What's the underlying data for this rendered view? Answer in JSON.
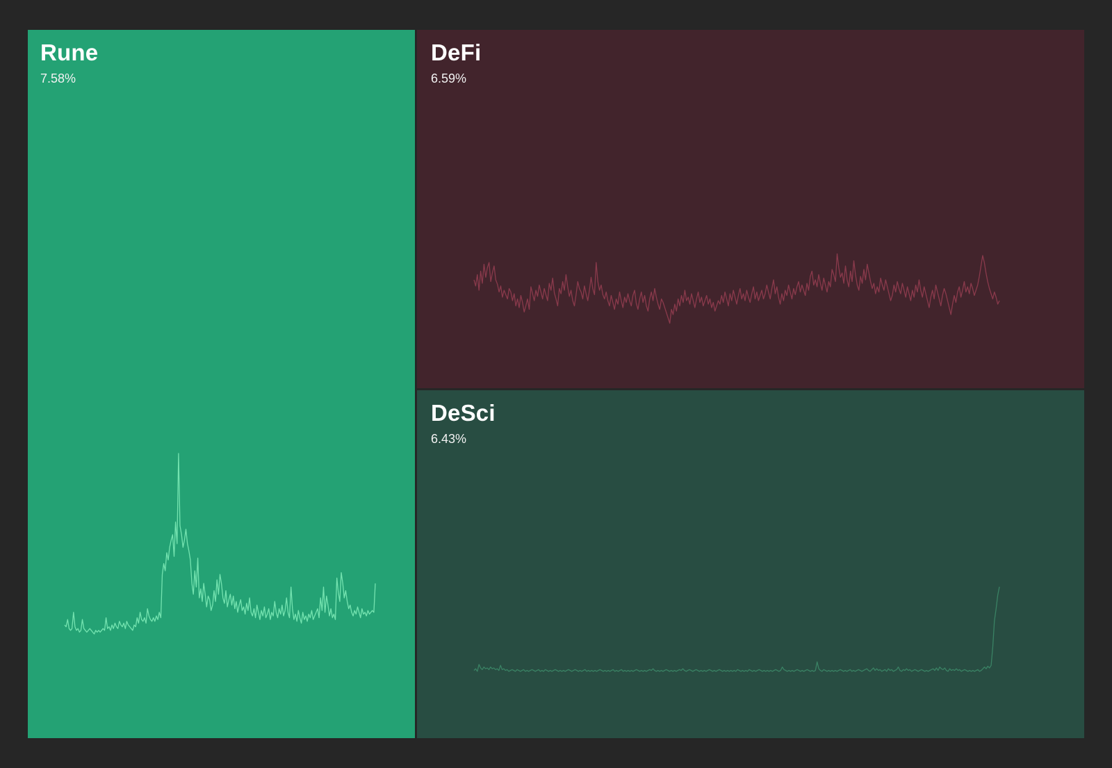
{
  "tiles": [
    {
      "id": "rune",
      "name": "Rune",
      "change": "7.58%",
      "background": "#24a274",
      "line_color": "#74e3b0",
      "sparkline": "0.05,0.04,0.08,0.03,0.02,0.03,0.12,0.04,0.02,0.03,0.01,0.02,0.08,0.03,0.02,0.01,0.02,0.03,0.02,0.01,0.0,0.02,0.01,0.02,0.01,0.02,0.03,0.02,0.09,0.03,0.04,0.02,0.05,0.03,0.06,0.04,0.03,0.07,0.05,0.04,0.06,0.03,0.07,0.05,0.04,0.03,0.02,0.05,0.04,0.09,0.06,0.12,0.08,0.07,0.09,0.06,0.14,0.1,0.08,0.07,0.09,0.07,0.1,0.08,0.12,0.09,0.33,0.39,0.35,0.45,0.41,0.48,0.52,0.55,0.43,0.62,0.5,1.0,0.6,0.55,0.48,0.52,0.58,0.5,0.46,0.41,0.28,0.22,0.35,0.26,0.42,0.2,0.25,0.18,0.28,0.22,0.15,0.21,0.19,0.13,0.16,0.24,0.18,0.3,0.22,0.33,0.28,0.2,0.17,0.24,0.15,0.19,0.22,0.16,0.21,0.14,0.18,0.12,0.16,0.19,0.13,0.15,0.11,0.17,0.13,0.2,0.12,0.1,0.14,0.09,0.16,0.12,0.08,0.13,0.1,0.15,0.09,0.11,0.14,0.08,0.12,0.1,0.18,0.12,0.09,0.14,0.11,0.16,0.1,0.13,0.2,0.12,0.09,0.26,0.14,0.08,0.11,0.07,0.13,0.09,0.06,0.12,0.08,0.1,0.07,0.11,0.09,0.13,0.08,0.1,0.12,0.14,0.09,0.2,0.13,0.26,0.12,0.21,0.16,0.1,0.14,0.09,0.11,0.08,0.31,0.23,0.18,0.34,0.28,0.2,0.24,0.18,0.14,0.16,0.12,0.1,0.13,0.11,0.15,0.12,0.09,0.14,0.11,0.12,0.1,0.13,0.11,0.12,0.13,0.12,0.28"
    },
    {
      "id": "defi",
      "name": "DeFi",
      "change": "6.59%",
      "background": "#42242c",
      "line_color": "#8a3a4c",
      "sparkline": "0.52,0.45,0.58,0.4,0.62,0.48,0.7,0.55,0.66,0.72,0.5,0.6,0.68,0.52,0.47,0.38,0.45,0.32,0.4,0.35,0.3,0.42,0.38,0.28,0.36,0.22,0.3,0.2,0.34,0.26,0.15,0.22,0.3,0.18,0.44,0.36,0.28,0.4,0.33,0.46,0.38,0.3,0.42,0.35,0.28,0.48,0.4,0.54,0.37,0.3,0.22,0.42,0.36,0.5,0.4,0.58,0.44,0.33,0.4,0.28,0.22,0.35,0.5,0.42,0.38,0.3,0.45,0.36,0.28,0.4,0.55,0.42,0.35,0.72,0.5,0.4,0.46,0.35,0.3,0.38,0.28,0.22,0.34,0.26,0.18,0.3,0.24,0.38,0.28,0.2,0.32,0.26,0.36,0.28,0.22,0.34,0.4,0.25,0.18,0.3,0.38,0.26,0.34,0.22,0.16,0.3,0.38,0.28,0.42,0.32,0.24,0.18,0.3,0.26,0.2,0.14,0.08,0.02,0.18,0.12,0.24,0.16,0.3,0.22,0.34,0.26,0.4,0.28,0.32,0.24,0.36,0.28,0.2,0.3,0.38,0.26,0.32,0.22,0.28,0.34,0.24,0.3,0.2,0.26,0.16,0.22,0.28,0.24,0.34,0.26,0.38,0.3,0.22,0.36,0.28,0.4,0.32,0.24,0.34,0.42,0.3,0.36,0.28,0.4,0.32,0.26,0.36,0.44,0.3,0.38,0.28,0.34,0.4,0.3,0.36,0.46,0.38,0.3,0.42,0.52,0.36,0.44,0.32,0.24,0.36,0.28,0.4,0.34,0.46,0.38,0.3,0.42,0.35,0.44,0.5,0.38,0.46,0.4,0.34,0.48,0.4,0.56,0.62,0.46,0.52,0.44,0.58,0.48,0.4,0.54,0.46,0.38,0.5,0.44,0.64,0.58,0.5,0.82,0.66,0.55,0.6,0.48,0.68,0.52,0.44,0.62,0.5,0.74,0.58,0.46,0.4,0.56,0.48,0.64,0.52,0.7,0.6,0.5,0.42,0.48,0.36,0.44,0.38,0.54,0.46,0.4,0.52,0.44,0.36,0.28,0.34,0.46,0.38,0.5,0.42,0.36,0.48,0.4,0.32,0.44,0.36,0.28,0.4,0.32,0.46,0.38,0.52,0.4,0.32,0.44,0.36,0.28,0.2,0.32,0.4,0.3,0.46,0.38,0.3,0.22,0.34,0.42,0.36,0.28,0.2,0.12,0.24,0.34,0.26,0.38,0.44,0.32,0.4,0.5,0.38,0.44,0.36,0.48,0.42,0.34,0.4,0.46,0.56,0.68,0.8,0.72,0.6,0.5,0.42,0.36,0.3,0.38,0.32,0.24,0.28"
    },
    {
      "id": "desci",
      "name": "DeSci",
      "change": "6.43%",
      "background": "#284d42",
      "line_color": "#3a8264",
      "sparkline": "0.02,0.04,0.01,0.09,0.05,0.03,0.06,0.04,0.05,0.03,0.06,0.04,0.05,0.03,0.04,0.02,0.08,0.03,0.04,0.02,0.03,0.01,0.02,0.03,0.02,0.01,0.03,0.02,0.01,0.02,0.03,0.01,0.02,0.01,0.02,0.03,0.02,0.01,0.02,0.03,0.01,0.02,0.01,0.03,0.02,0.01,0.02,0.01,0.02,0.03,0.02,0.01,0.02,0.01,0.02,0.01,0.02,0.03,0.02,0.01,0.02,0.03,0.02,0.01,0.02,0.01,0.02,0.03,0.01,0.02,0.01,0.02,0.01,0.02,0.01,0.02,0.03,0.02,0.01,0.02,0.01,0.02,0.01,0.02,0.03,0.01,0.02,0.01,0.02,0.03,0.01,0.02,0.01,0.02,0.01,0.02,0.01,0.02,0.03,0.02,0.01,0.02,0.01,0.02,0.01,0.02,0.03,0.02,0.04,0.02,0.01,0.02,0.01,0.02,0.01,0.02,0.03,0.02,0.01,0.02,0.01,0.02,0.01,0.02,0.03,0.02,0.04,0.02,0.01,0.02,0.03,0.02,0.01,0.02,0.03,0.02,0.01,0.02,0.01,0.02,0.01,0.02,0.03,0.02,0.01,0.02,0.01,0.02,0.03,0.02,0.01,0.02,0.01,0.02,0.01,0.02,0.01,0.02,0.01,0.03,0.02,0.01,0.02,0.01,0.02,0.01,0.03,0.02,0.01,0.02,0.01,0.02,0.03,0.02,0.01,0.02,0.01,0.02,0.01,0.02,0.01,0.02,0.03,0.02,0.01,0.02,0.06,0.03,0.02,0.01,0.02,0.01,0.02,0.01,0.02,0.03,0.02,0.01,0.02,0.01,0.02,0.03,0.02,0.01,0.02,0.01,0.02,0.12,0.04,0.02,0.01,0.03,0.02,0.01,0.02,0.01,0.02,0.01,0.02,0.01,0.02,0.03,0.02,0.01,0.02,0.01,0.02,0.03,0.01,0.02,0.01,0.02,0.03,0.02,0.01,0.02,0.03,0.04,0.02,0.01,0.03,0.05,0.02,0.04,0.02,0.03,0.01,0.02,0.03,0.01,0.04,0.02,0.03,0.01,0.02,0.03,0.06,0.02,0.01,0.03,0.02,0.04,0.02,0.03,0.01,0.02,0.03,0.02,0.01,0.02,0.03,0.02,0.01,0.02,0.01,0.02,0.03,0.04,0.02,0.05,0.02,0.06,0.04,0.03,0.05,0.02,0.01,0.04,0.02,0.03,0.02,0.04,0.02,0.03,0.01,0.02,0.03,0.02,0.01,0.02,0.01,0.02,0.01,0.02,0.03,0.01,0.02,0.04,0.06,0.04,0.07,0.05,0.08,0.3,0.6,0.74,0.9,1.0"
    }
  ]
}
